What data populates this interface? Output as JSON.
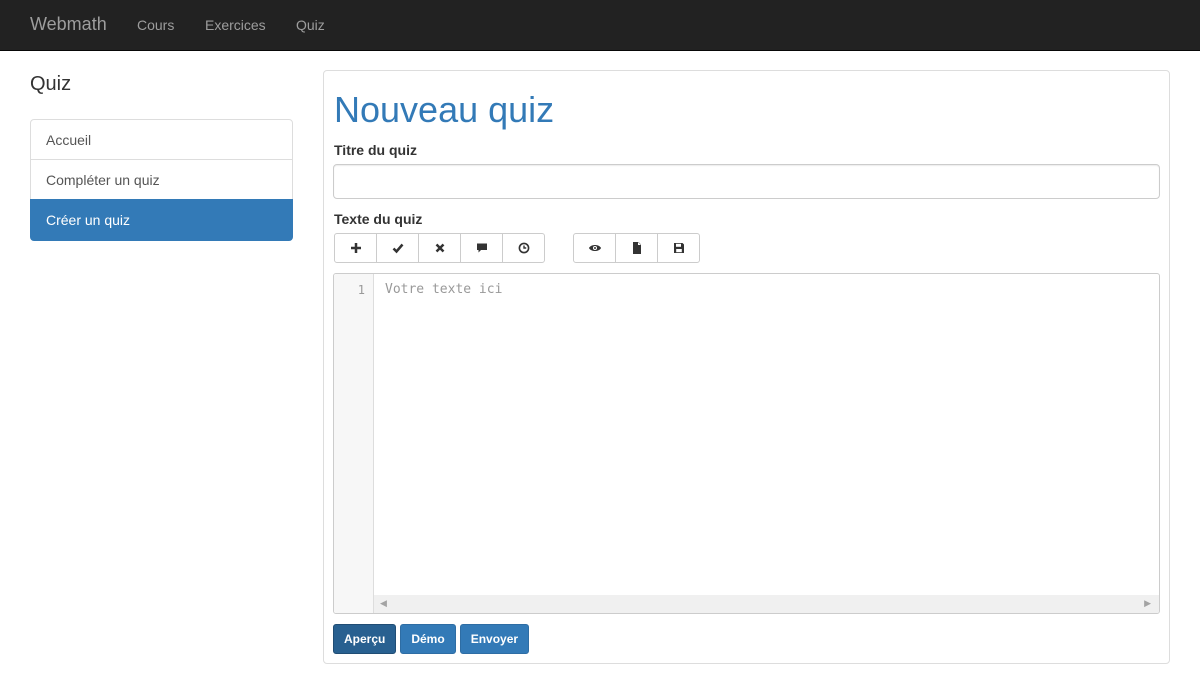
{
  "navbar": {
    "brand": "Webmath",
    "links": [
      "Cours",
      "Exercices",
      "Quiz"
    ]
  },
  "sidebar": {
    "title": "Quiz",
    "items": [
      {
        "label": "Accueil",
        "active": false
      },
      {
        "label": "Compléter un quiz",
        "active": false
      },
      {
        "label": "Créer un quiz",
        "active": true
      }
    ]
  },
  "main": {
    "title": "Nouveau quiz",
    "title_field_label": "Titre du quiz",
    "title_field_value": "",
    "text_field_label": "Texte du quiz",
    "toolbar_group1": [
      "plus-icon",
      "check-icon",
      "cross-icon",
      "comment-icon",
      "clock-icon"
    ],
    "toolbar_group2": [
      "eye-icon",
      "file-icon",
      "save-icon"
    ],
    "editor": {
      "line_number": "1",
      "placeholder": "Votre texte ici"
    },
    "actions": [
      "Aperçu",
      "Démo",
      "Envoyer"
    ]
  },
  "colors": {
    "primary": "#337ab7",
    "navbar_bg": "#222222"
  }
}
